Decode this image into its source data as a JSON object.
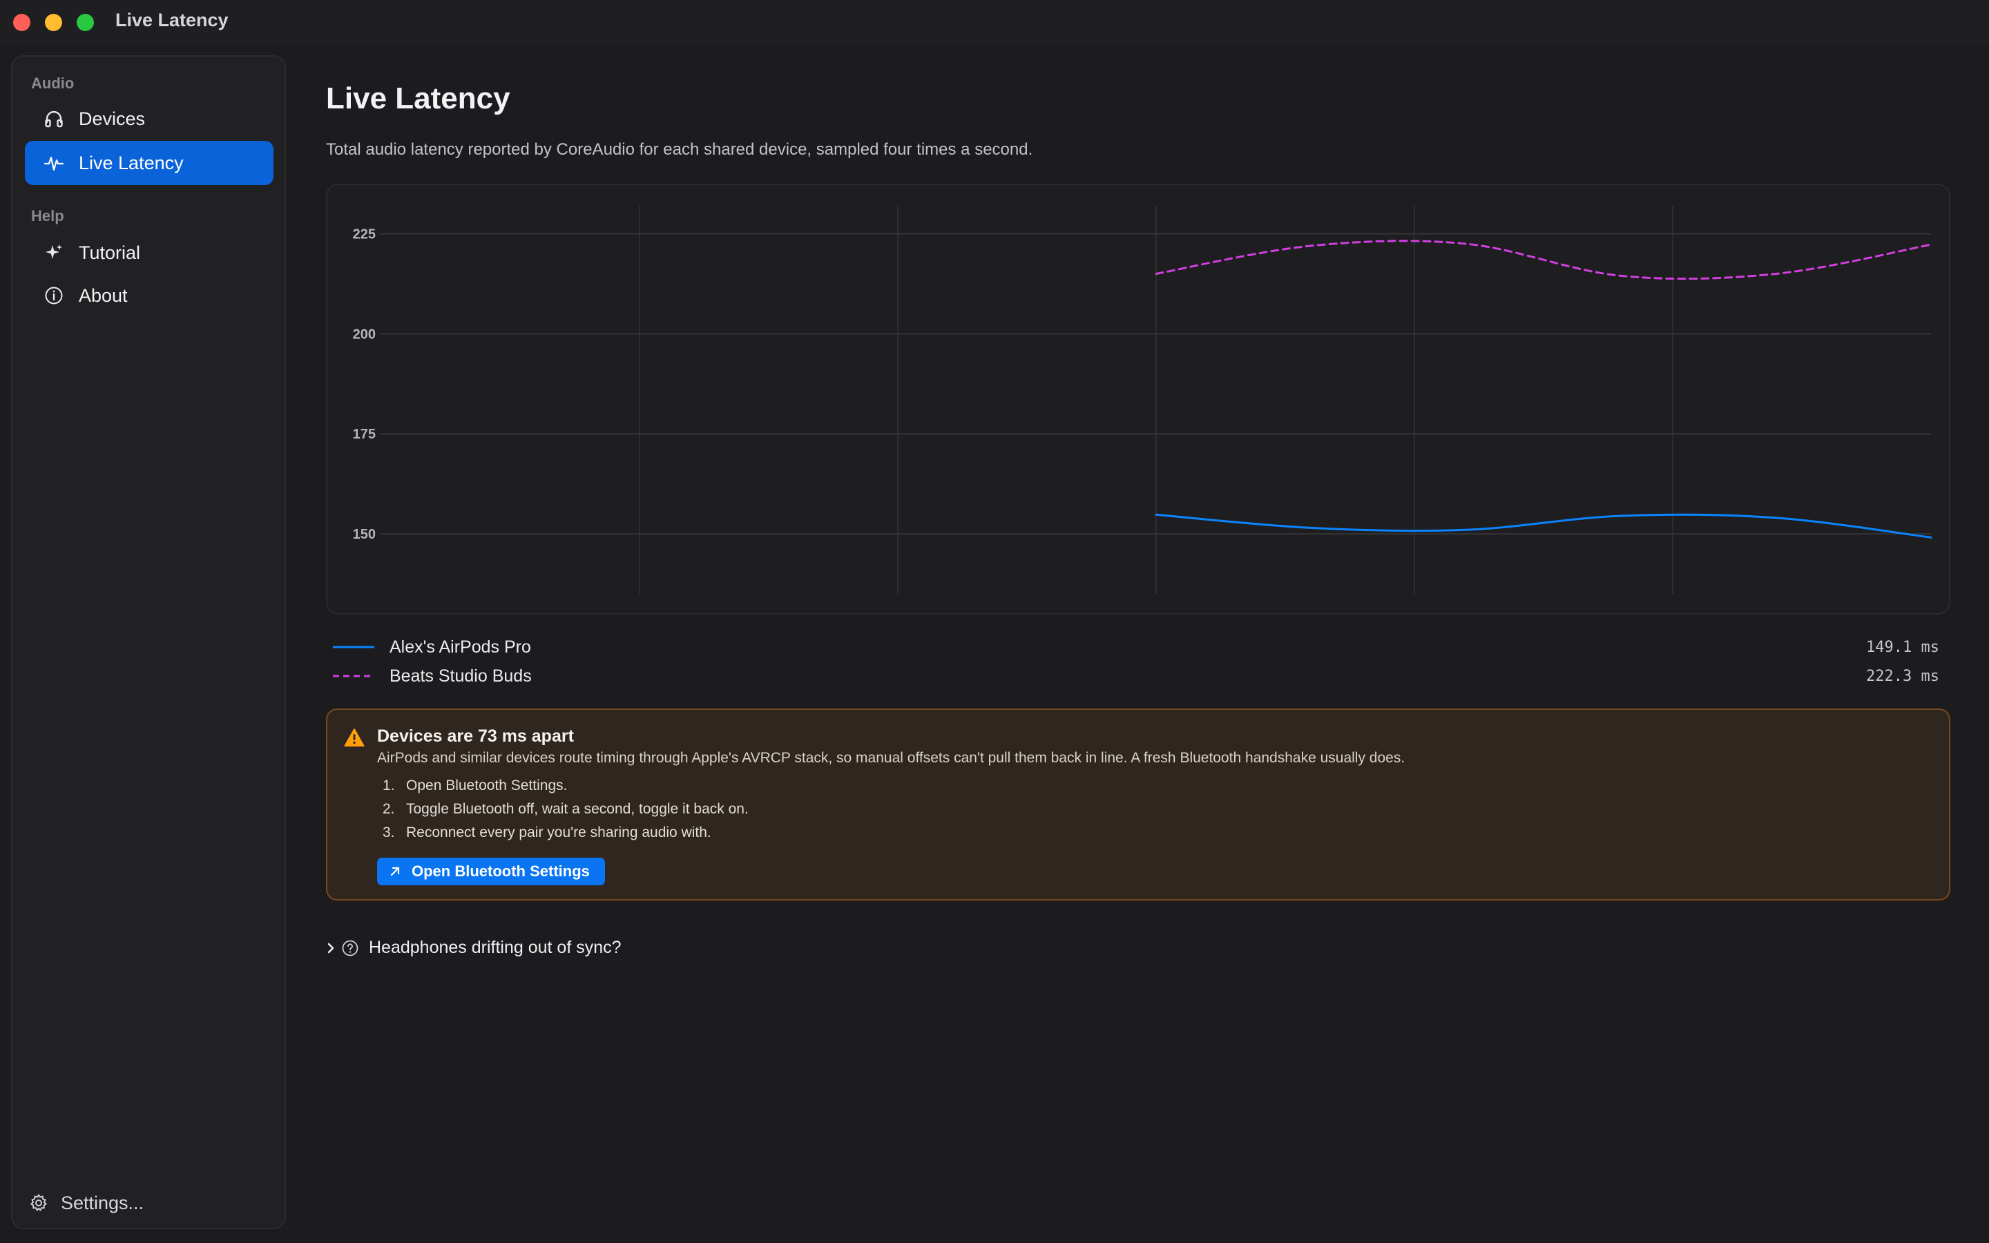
{
  "window": {
    "title": "Live Latency"
  },
  "sidebar": {
    "sections": [
      {
        "label": "Audio",
        "items": [
          {
            "label": "Devices",
            "icon": "headphones-icon",
            "active": false
          },
          {
            "label": "Live Latency",
            "icon": "waveform-icon",
            "active": true
          }
        ]
      },
      {
        "label": "Help",
        "items": [
          {
            "label": "Tutorial",
            "icon": "sparkles-icon",
            "active": false
          },
          {
            "label": "About",
            "icon": "info-icon",
            "active": false
          }
        ]
      }
    ],
    "settings_label": "Settings..."
  },
  "main": {
    "title": "Live Latency",
    "subtitle": "Total audio latency reported by CoreAudio for each shared device, sampled four times a second."
  },
  "chart_data": {
    "type": "line",
    "title": "",
    "xlabel": "",
    "ylabel": "",
    "ylim": [
      135,
      232
    ],
    "yticks": [
      150,
      175,
      200,
      225
    ],
    "grid": true,
    "x": [
      0,
      1,
      2,
      3,
      4,
      5,
      6,
      7,
      8,
      9,
      10
    ],
    "series": [
      {
        "name": "Alex's AirPods Pro",
        "color": "#0a84ff",
        "dash": "solid",
        "values": [
          null,
          null,
          null,
          null,
          null,
          154.8,
          151.5,
          151.0,
          154.5,
          154.0,
          149.1
        ]
      },
      {
        "name": "Beats Studio Buds",
        "color": "#d13fe0",
        "dash": "dashed",
        "values": [
          null,
          null,
          null,
          null,
          null,
          215.0,
          222.0,
          222.5,
          214.5,
          215.0,
          222.3
        ]
      }
    ]
  },
  "legend": [
    {
      "name": "Alex's AirPods Pro",
      "value": "149.1 ms",
      "color": "#0a84ff",
      "style": "solid"
    },
    {
      "name": "Beats Studio Buds",
      "value": "222.3 ms",
      "color": "#d13fe0",
      "style": "dashed"
    }
  ],
  "warning": {
    "icon": "warning-triangle-icon",
    "title": "Devices are 73 ms apart",
    "description": "AirPods and similar devices route timing through Apple's AVRCP stack, so manual offsets can't pull them back in line. A fresh Bluetooth handshake usually does.",
    "steps": [
      {
        "num": "1.",
        "text": "Open Bluetooth Settings."
      },
      {
        "num": "2.",
        "text": "Toggle Bluetooth off, wait a second, toggle it back on."
      },
      {
        "num": "3.",
        "text": "Reconnect every pair you're sharing audio with."
      }
    ],
    "button_label": "Open Bluetooth Settings"
  },
  "disclosure": {
    "label": "Headphones drifting out of sync?"
  }
}
